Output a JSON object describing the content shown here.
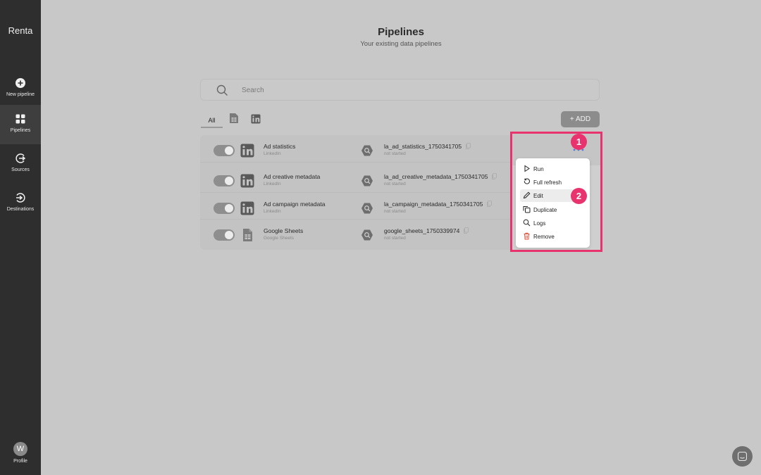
{
  "app": {
    "brand": "Renta"
  },
  "sidebar": {
    "items": [
      {
        "label": "New pipeline",
        "icon": "plus-circle-icon"
      },
      {
        "label": "Pipelines",
        "icon": "grid-icon",
        "active": true
      },
      {
        "label": "Sources",
        "icon": "source-icon"
      },
      {
        "label": "Destinations",
        "icon": "destination-icon"
      }
    ],
    "profile": {
      "initial": "W",
      "label": "Profile"
    }
  },
  "header": {
    "title": "Pipelines",
    "subtitle": "Your existing data pipelines"
  },
  "search": {
    "placeholder": "Search"
  },
  "tabs": [
    {
      "label": "All",
      "active": true
    },
    {
      "icon": "google-sheets-icon"
    },
    {
      "icon": "linkedin-icon"
    }
  ],
  "add_button": {
    "label": "+ ADD"
  },
  "pipelines": [
    {
      "name": "Ad statistics",
      "source": "LinkedIn",
      "source_icon": "linkedin-icon",
      "table": "la_ad_statistics_1750341705",
      "status": "not started",
      "enabled": true
    },
    {
      "name": "Ad creative metadata",
      "source": "LinkedIn",
      "source_icon": "linkedin-icon",
      "table": "la_ad_creative_metadata_1750341705",
      "status": "not started",
      "enabled": true
    },
    {
      "name": "Ad campaign metadata",
      "source": "LinkedIn",
      "source_icon": "linkedin-icon",
      "table": "la_campaign_metadata_1750341705",
      "status": "not started",
      "enabled": true
    },
    {
      "name": "Google Sheets",
      "source": "Google Sheets",
      "source_icon": "google-sheets-icon",
      "table": "google_sheets_1750339974",
      "status": "not started",
      "enabled": true
    }
  ],
  "context_menu": {
    "items": [
      {
        "label": "Run",
        "icon": "play-icon"
      },
      {
        "label": "Full refresh",
        "icon": "refresh-icon"
      },
      {
        "label": "Edit",
        "icon": "pencil-icon"
      },
      {
        "label": "Duplicate",
        "icon": "duplicate-icon"
      },
      {
        "label": "Logs",
        "icon": "search-icon"
      },
      {
        "label": "Remove",
        "icon": "trash-icon",
        "color": "#e0503a"
      }
    ]
  },
  "annotations": {
    "badge_1": "1",
    "badge_2": "2",
    "color": "#e8336f"
  }
}
